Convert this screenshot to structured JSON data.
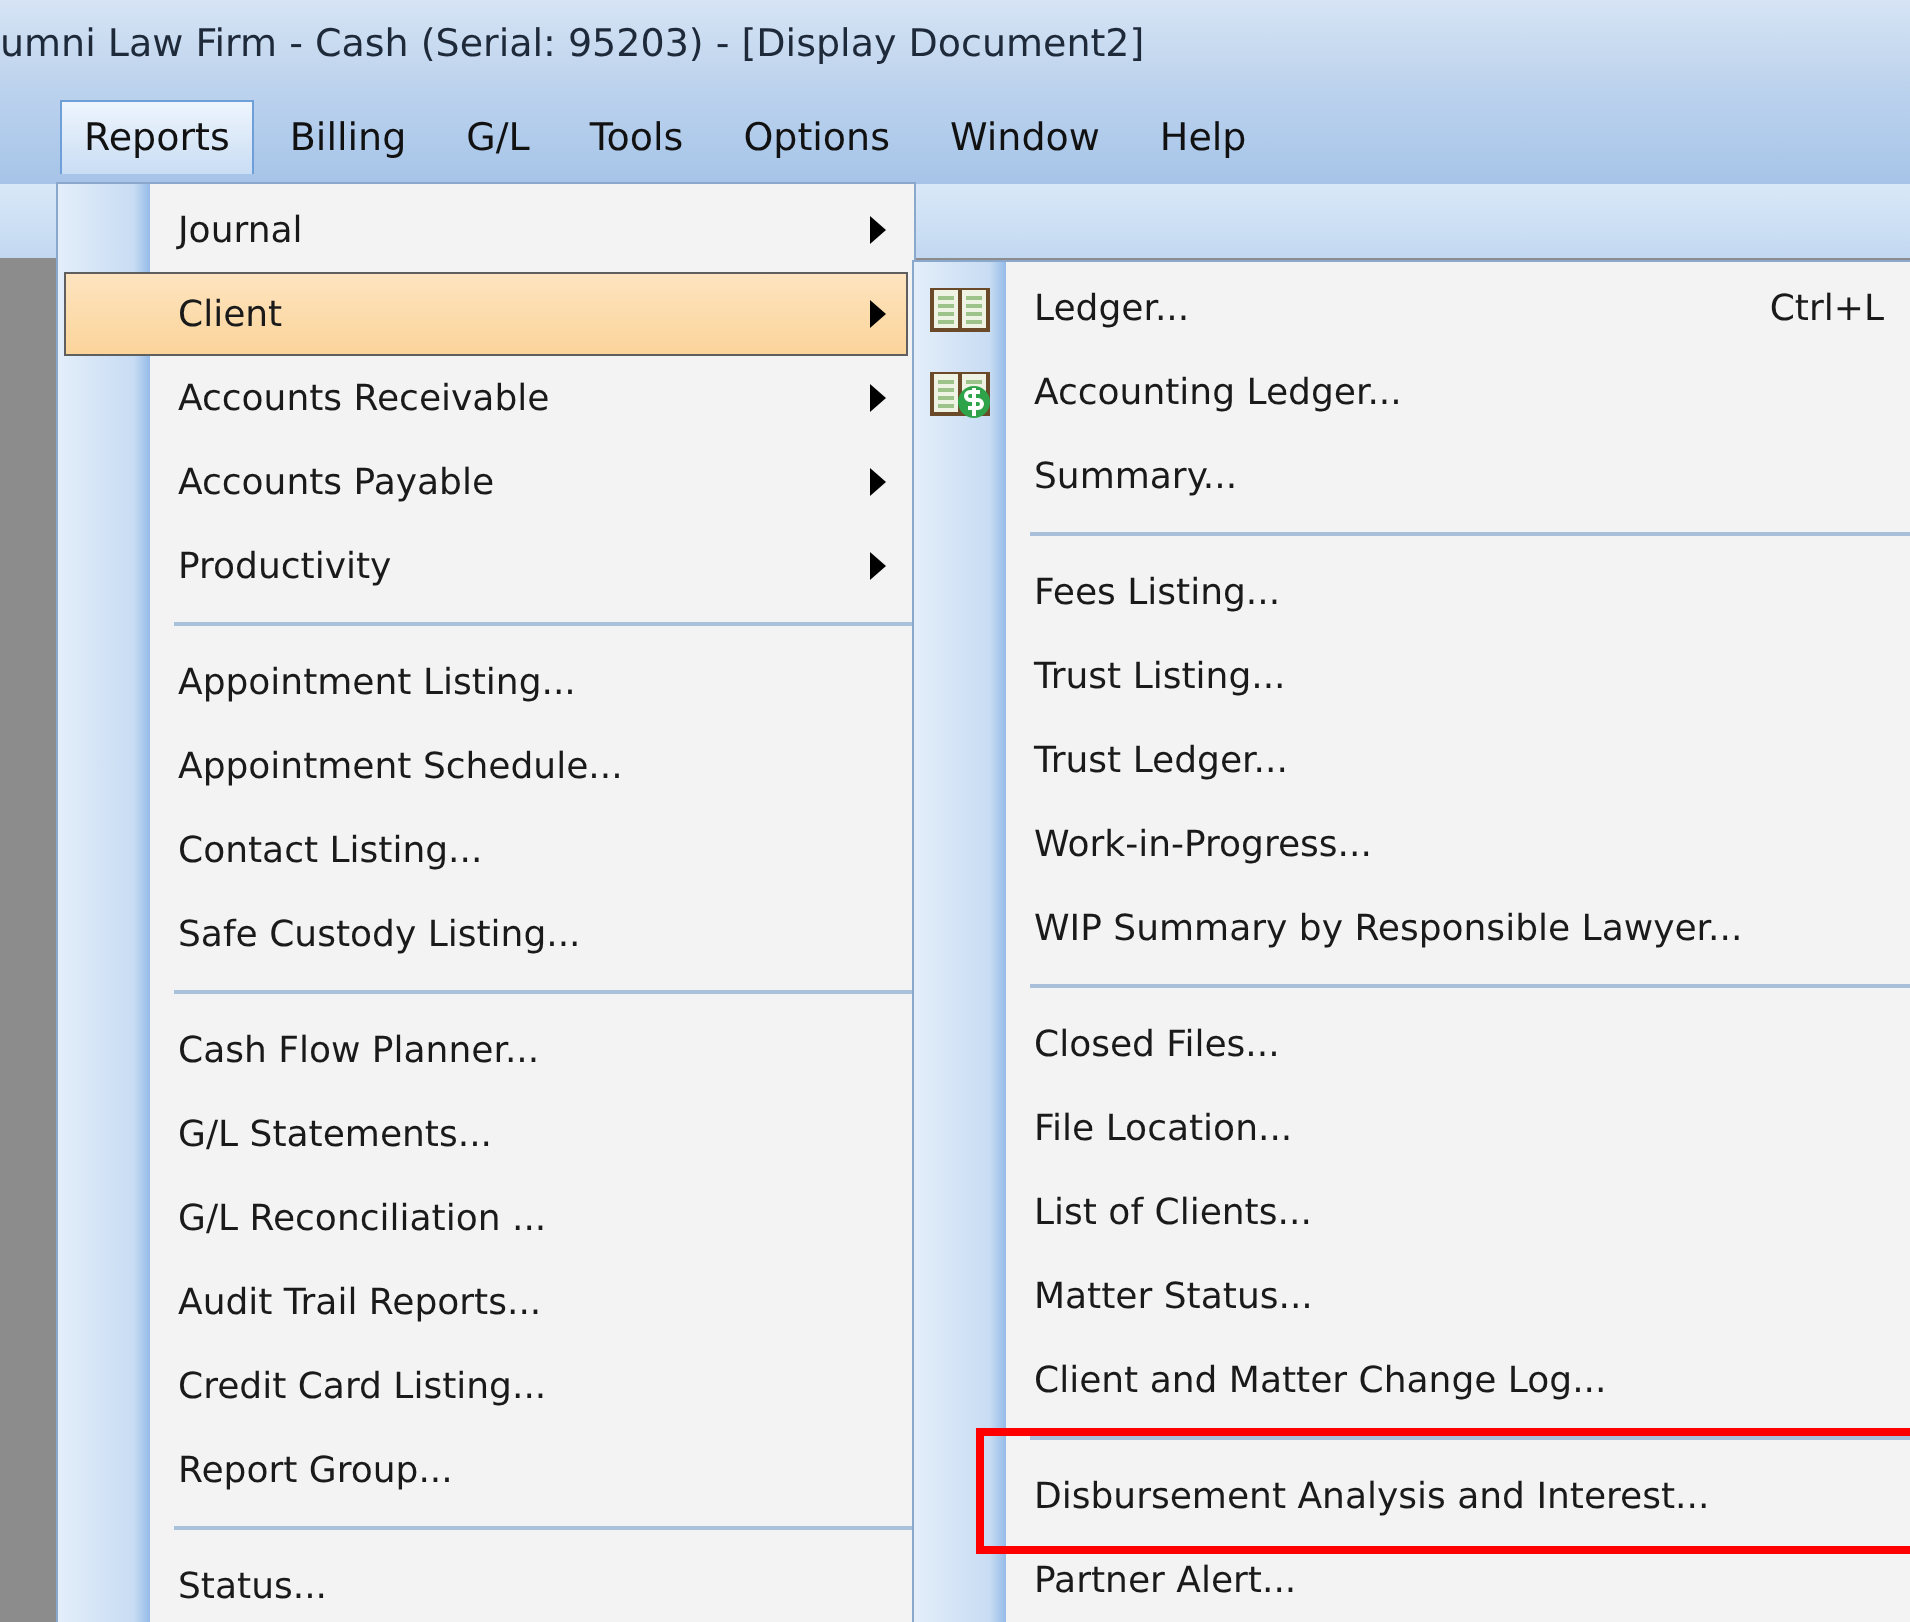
{
  "window": {
    "title": "umni Law Firm - Cash (Serial:  95203) - [Display Document2]"
  },
  "menu_bar": [
    {
      "label": "Reports",
      "selected": true
    },
    {
      "label": "Billing",
      "selected": false
    },
    {
      "label": "G/L",
      "selected": false
    },
    {
      "label": "Tools",
      "selected": false
    },
    {
      "label": "Options",
      "selected": false
    },
    {
      "label": "Window",
      "selected": false
    },
    {
      "label": "Help",
      "selected": false
    }
  ],
  "reports_menu": [
    {
      "kind": "item",
      "label": "Journal",
      "submenu": true,
      "selected": false
    },
    {
      "kind": "item",
      "label": "Client",
      "submenu": true,
      "selected": true
    },
    {
      "kind": "item",
      "label": "Accounts Receivable",
      "submenu": true,
      "selected": false
    },
    {
      "kind": "item",
      "label": "Accounts Payable",
      "submenu": true,
      "selected": false
    },
    {
      "kind": "item",
      "label": "Productivity",
      "submenu": true,
      "selected": false
    },
    {
      "kind": "separator"
    },
    {
      "kind": "item",
      "label": "Appointment Listing...",
      "submenu": false,
      "selected": false
    },
    {
      "kind": "item",
      "label": "Appointment Schedule...",
      "submenu": false,
      "selected": false
    },
    {
      "kind": "item",
      "label": "Contact Listing...",
      "submenu": false,
      "selected": false
    },
    {
      "kind": "item",
      "label": "Safe Custody Listing...",
      "submenu": false,
      "selected": false
    },
    {
      "kind": "separator"
    },
    {
      "kind": "item",
      "label": "Cash Flow Planner...",
      "submenu": false,
      "selected": false
    },
    {
      "kind": "item",
      "label": "G/L Statements...",
      "submenu": false,
      "selected": false
    },
    {
      "kind": "item",
      "label": "G/L Reconciliation ...",
      "submenu": false,
      "selected": false
    },
    {
      "kind": "item",
      "label": "Audit Trail Reports...",
      "submenu": false,
      "selected": false
    },
    {
      "kind": "item",
      "label": "Credit Card Listing...",
      "submenu": false,
      "selected": false
    },
    {
      "kind": "item",
      "label": "Report Group...",
      "submenu": false,
      "selected": false
    },
    {
      "kind": "separator"
    },
    {
      "kind": "item",
      "label": "Status...",
      "submenu": false,
      "selected": false
    }
  ],
  "client_submenu": [
    {
      "kind": "book",
      "label": "Ledger...",
      "shortcut": "Ctrl+L",
      "highlighted": false
    },
    {
      "kind": "cashbook",
      "label": "Accounting Ledger...",
      "highlighted": false
    },
    {
      "kind": "item",
      "label": "Summary...",
      "highlighted": false
    },
    {
      "kind": "separator"
    },
    {
      "kind": "item",
      "label": "Fees Listing...",
      "highlighted": false
    },
    {
      "kind": "item",
      "label": "Trust Listing...",
      "highlighted": false
    },
    {
      "kind": "item",
      "label": "Trust Ledger...",
      "highlighted": false
    },
    {
      "kind": "item",
      "label": "Work-in-Progress...",
      "highlighted": false
    },
    {
      "kind": "item",
      "label": "WIP Summary by Responsible Lawyer...",
      "highlighted": false
    },
    {
      "kind": "separator"
    },
    {
      "kind": "item",
      "label": "Closed Files...",
      "highlighted": false
    },
    {
      "kind": "item",
      "label": "File Location...",
      "highlighted": false
    },
    {
      "kind": "item",
      "label": "List of Clients...",
      "highlighted": false
    },
    {
      "kind": "item",
      "label": "Matter Status...",
      "highlighted": false
    },
    {
      "kind": "item",
      "label": "Client and Matter Change Log...",
      "highlighted": false
    },
    {
      "kind": "separator"
    },
    {
      "kind": "item",
      "label": "Disbursement Analysis and Interest...",
      "highlighted": true
    },
    {
      "kind": "item",
      "label": "Partner Alert...",
      "highlighted": false
    }
  ]
}
